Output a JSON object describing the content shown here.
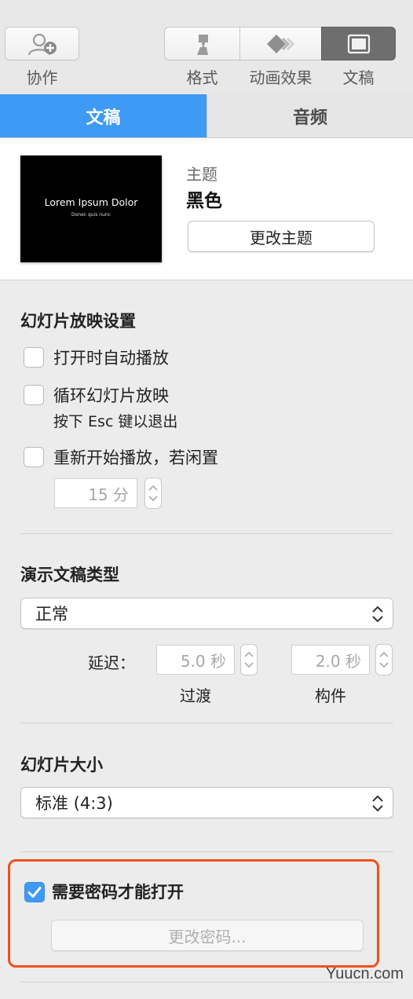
{
  "toolbar": {
    "collaborate_label": "协作",
    "format_label": "格式",
    "animate_label": "动画效果",
    "document_label": "文稿"
  },
  "tabs": {
    "document": "文稿",
    "audio": "音频"
  },
  "theme": {
    "thumb_title": "Lorem Ipsum Dolor",
    "thumb_subtitle": "Donec quis nunc",
    "label": "主题",
    "name": "黑色",
    "change_button": "更改主题"
  },
  "slideshow": {
    "title": "幻灯片放映设置",
    "autoplay_label": "打开时自动播放",
    "autoplay_checked": false,
    "loop_label": "循环幻灯片放映",
    "esc_hint": "按下 Esc 键以退出",
    "loop_checked": false,
    "restart_label": "重新开始播放，若闲置",
    "restart_checked": false,
    "idle_value": "15 分"
  },
  "presentation_type": {
    "title": "演示文稿类型",
    "selected": "正常",
    "delay_label": "延迟：",
    "transition_value": "5.0 秒",
    "transition_label": "过渡",
    "build_value": "2.0 秒",
    "build_label": "构件"
  },
  "slide_size": {
    "title": "幻灯片大小",
    "selected": "标准 (4:3)"
  },
  "password": {
    "require_label": "需要密码才能打开",
    "require_checked": true,
    "change_button": "更改密码..."
  },
  "watermark": "Yuucn.com",
  "colors": {
    "accent": "#3f9af5",
    "highlight": "#f0501e"
  }
}
